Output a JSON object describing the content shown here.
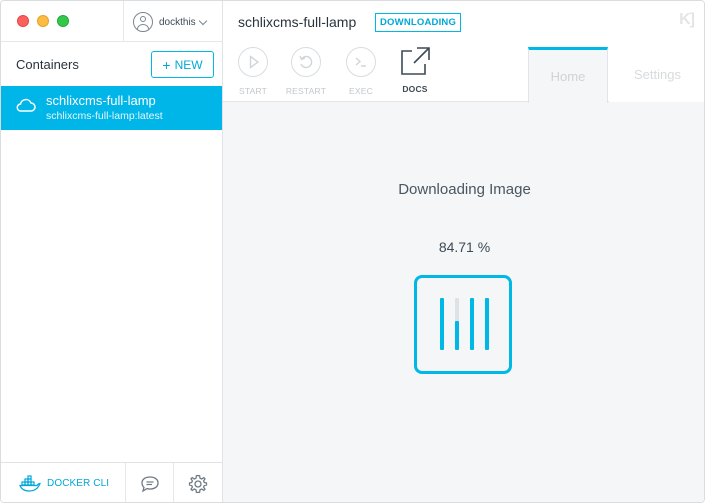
{
  "window": {
    "title": "schlixcms-full-lamp"
  },
  "user": {
    "name": "dockthis"
  },
  "sidebar": {
    "heading": "Containers",
    "new_button": {
      "label": "NEW",
      "icon": "plus-icon"
    },
    "containers": [
      {
        "name": "schlixcms-full-lamp",
        "image": "schlixcms-full-lamp:latest",
        "icon": "cloud-icon",
        "selected": true
      }
    ],
    "footer": {
      "docker_cli_label": "DOCKER CLI",
      "docker_cli_icon": "docker-whale-icon",
      "chat_icon": "chat-bubble-icon",
      "settings_icon": "gear-icon"
    }
  },
  "header": {
    "container_name": "schlixcms-full-lamp",
    "status": "DOWNLOADING",
    "logo_icon": "kitematic-logo-icon",
    "actions": [
      {
        "label": "START",
        "icon": "play-icon",
        "enabled": false
      },
      {
        "label": "RESTART",
        "icon": "restart-icon",
        "enabled": false
      },
      {
        "label": "EXEC",
        "icon": "terminal-icon",
        "enabled": false
      },
      {
        "label": "DOCS",
        "icon": "external-link-icon",
        "enabled": true
      }
    ],
    "tabs": [
      {
        "label": "Home",
        "active": true
      },
      {
        "label": "Settings",
        "active": false
      }
    ]
  },
  "download": {
    "title": "Downloading Image",
    "percent_text": "84.71 %",
    "percent": 84.71,
    "layer_progress": [
      1.0,
      0.55,
      1.0,
      1.0
    ]
  },
  "colors": {
    "accent": "#00b8e6",
    "selected_bg": "#00b6e8",
    "traffic_red": "#fc605c",
    "traffic_yellow": "#fdbc40",
    "traffic_green": "#34c84a"
  }
}
